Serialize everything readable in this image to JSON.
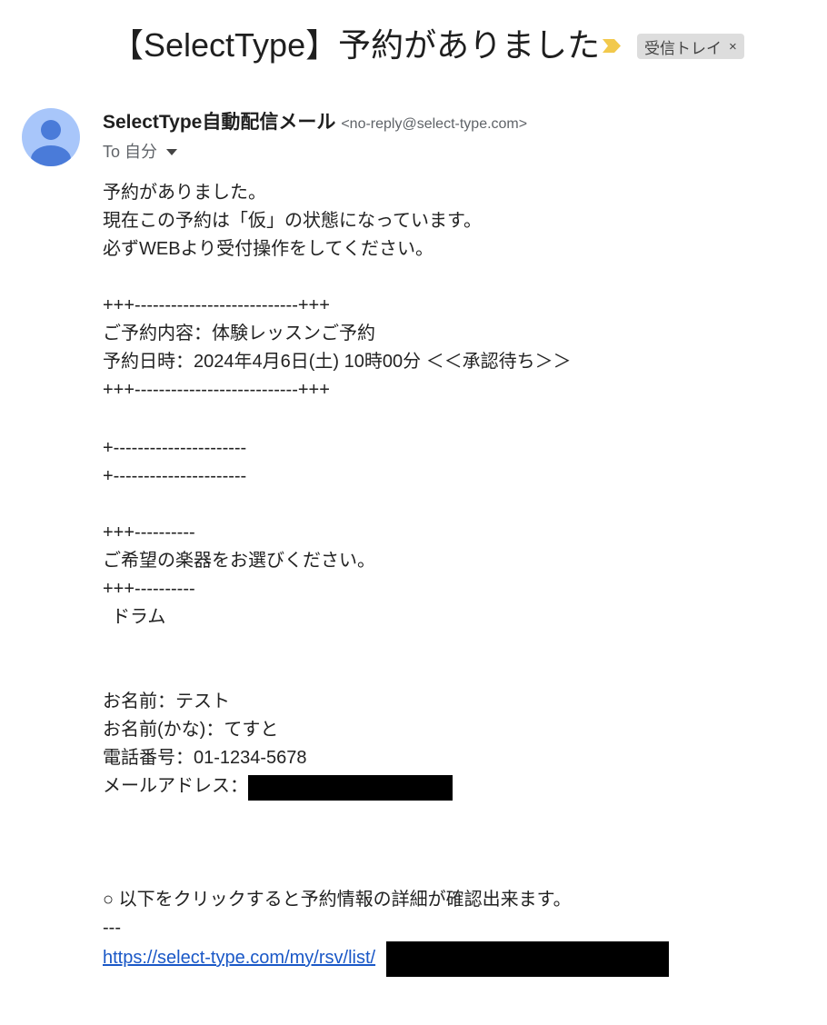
{
  "subject": "【SelectType】予約がありました",
  "label": {
    "name": "受信トレイ",
    "close": "×"
  },
  "sender": {
    "name": "SelectType自動配信メール",
    "email": "<no-reply@select-type.com>"
  },
  "recipient": "To 自分",
  "body": {
    "intro": [
      "予約がありました。",
      "現在この予約は「仮」の状態になっています。",
      "必ずWEBより受付操作をしてください。"
    ],
    "booking_divider": "+++---------------------------+++",
    "booking_content": "ご予約内容：体験レッスンご予約",
    "booking_datetime": "予約日時：2024年4月6日(土) 10時00分 ＜＜承認待ち＞＞",
    "short_divider": "+----------------------",
    "question_divider": "+++----------",
    "question": "ご希望の楽器をお選びください。",
    "answer": "ドラム",
    "name_label": "お名前：テスト",
    "name_kana_label": "お名前(かな)：てすと",
    "phone_label": "電話番号：01-1234-5678",
    "email_label": "メールアドレス：",
    "detail_note": "○ 以下をクリックすると予約情報の詳細が確認出来ます。",
    "detail_sep": "---",
    "detail_link": "https://select-type.com/my/rsv/list/"
  },
  "colors": {
    "avatar_bg": "#a8c6fa",
    "avatar_fg": "#4a7bd9",
    "importance": "#f2c94c",
    "link": "#1a58c7"
  },
  "icons": {
    "importance": "importance-marker-icon",
    "avatar": "person-icon",
    "dropdown": "caret-down-icon"
  }
}
